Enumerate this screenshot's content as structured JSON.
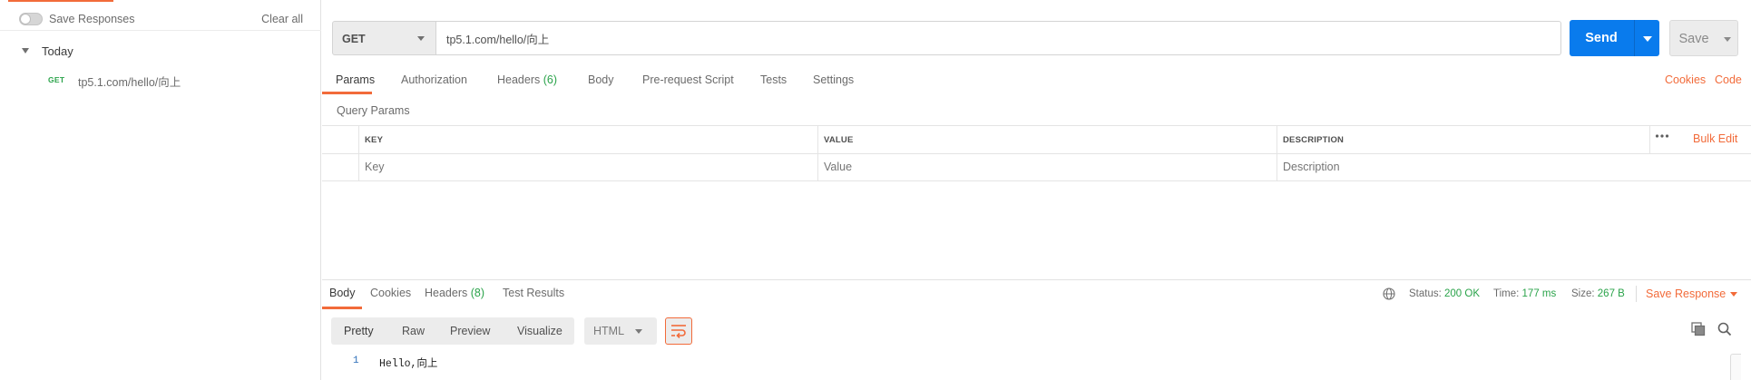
{
  "sidebar": {
    "save_responses_label": "Save Responses",
    "clear_all_label": "Clear all",
    "group_label": "Today",
    "history": [
      {
        "method": "GET",
        "url": "tp5.1.com/hello/向上"
      }
    ]
  },
  "request": {
    "method": "GET",
    "url": "tp5.1.com/hello/向上",
    "send_label": "Send",
    "save_label": "Save"
  },
  "request_tabs": {
    "params": "Params",
    "authorization": "Authorization",
    "headers": "Headers",
    "headers_count": "(6)",
    "body": "Body",
    "pre_request_script": "Pre-request Script",
    "tests": "Tests",
    "settings": "Settings",
    "cookies": "Cookies",
    "code": "Code"
  },
  "params": {
    "section_label": "Query Params",
    "columns": {
      "key": "KEY",
      "value": "VALUE",
      "description": "DESCRIPTION"
    },
    "bulk_edit_label": "Bulk Edit",
    "placeholders": {
      "key": "Key",
      "value": "Value",
      "description": "Description"
    }
  },
  "response": {
    "tabs": {
      "body": "Body",
      "cookies": "Cookies",
      "headers": "Headers",
      "headers_count": "(8)",
      "test_results": "Test Results"
    },
    "status_label": "Status:",
    "status_value": "200 OK",
    "time_label": "Time:",
    "time_value": "177 ms",
    "size_label": "Size:",
    "size_value": "267 B",
    "save_response_label": "Save Response",
    "views": {
      "pretty": "Pretty",
      "raw": "Raw",
      "preview": "Preview",
      "visualize": "Visualize"
    },
    "format": "HTML",
    "body_lines": [
      {
        "number": "1",
        "text": "Hello,向上"
      }
    ]
  },
  "colors": {
    "accent": "#f26b3a",
    "send_blue": "#097bed",
    "success_green": "#2aa34a"
  },
  "icons": [
    "toggle-switch",
    "caret-down-icon",
    "globe-icon",
    "ellipsis-icon",
    "wrap-lines-icon",
    "copy-icon",
    "search-icon"
  ]
}
